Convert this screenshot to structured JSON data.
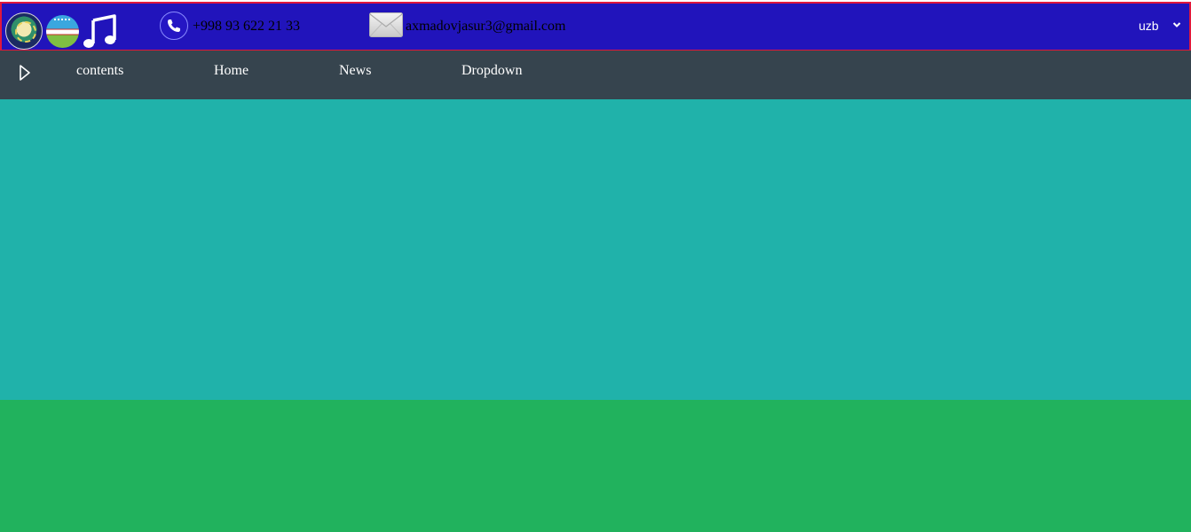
{
  "header": {
    "phone": "+998 93 622 21 33",
    "email": "axmadovjasur3@gmail.com",
    "language": {
      "selected": "uzb"
    },
    "icons": {
      "emblem": "uzbekistan-emblem-icon",
      "flag": "uzbekistan-flag-icon",
      "music": "music-note-icon",
      "phone": "phone-icon",
      "mail": "envelope-icon",
      "dropdown": "chevron-down-icon"
    }
  },
  "nav": {
    "toggle_icon": "triangle-right-icon",
    "items": [
      {
        "label": "contents"
      },
      {
        "label": "Home"
      },
      {
        "label": "News"
      },
      {
        "label": "Dropdown"
      }
    ]
  },
  "colors": {
    "topbar": "#2114bb",
    "topbar_border": "#e0183c",
    "navbar": "#36444e",
    "teal_section": "#20b2aa",
    "green_section": "#21b25d"
  }
}
